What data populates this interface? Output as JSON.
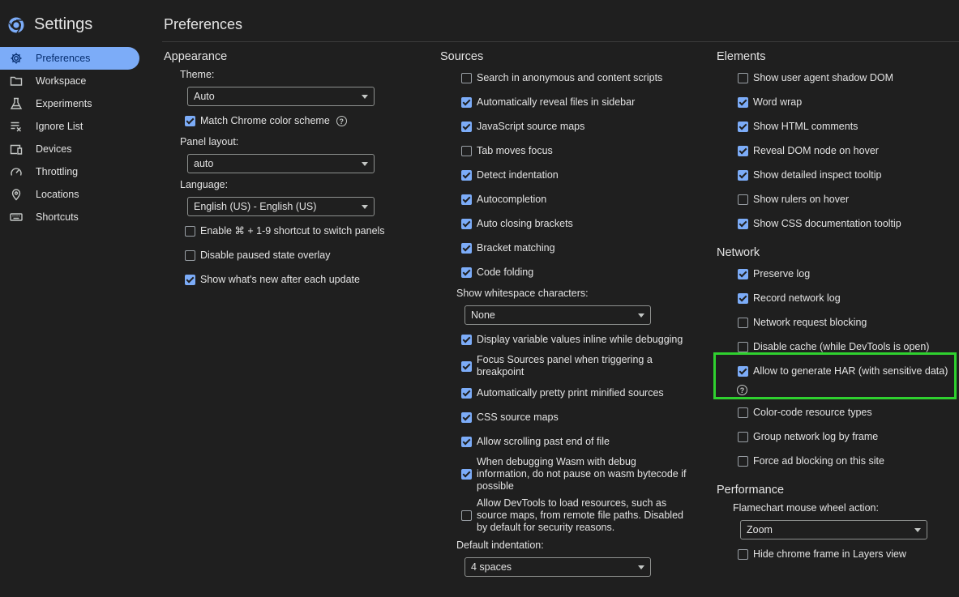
{
  "app": {
    "title": "Settings"
  },
  "sidebar": {
    "items": [
      {
        "label": "Preferences",
        "icon": "gear-icon",
        "active": true
      },
      {
        "label": "Workspace",
        "icon": "folder-icon",
        "active": false
      },
      {
        "label": "Experiments",
        "icon": "flask-icon",
        "active": false
      },
      {
        "label": "Ignore List",
        "icon": "ignore-list-icon",
        "active": false
      },
      {
        "label": "Devices",
        "icon": "devices-icon",
        "active": false
      },
      {
        "label": "Throttling",
        "icon": "speedometer-icon",
        "active": false
      },
      {
        "label": "Locations",
        "icon": "location-pin-icon",
        "active": false
      },
      {
        "label": "Shortcuts",
        "icon": "keyboard-icon",
        "active": false
      }
    ]
  },
  "page": {
    "title": "Preferences"
  },
  "appearance": {
    "title": "Appearance",
    "theme_label": "Theme:",
    "theme_value": "Auto",
    "match_color_scheme": {
      "label": "Match Chrome color scheme",
      "checked": true
    },
    "panel_layout_label": "Panel layout:",
    "panel_layout_value": "auto",
    "language_label": "Language:",
    "language_value": "English (US) - English (US)",
    "options": [
      {
        "label": "Enable ⌘ + 1-9 shortcut to switch panels",
        "checked": false
      },
      {
        "label": "Disable paused state overlay",
        "checked": false
      },
      {
        "label": "Show what's new after each update",
        "checked": true
      }
    ]
  },
  "sources": {
    "title": "Sources",
    "options": [
      {
        "label": "Search in anonymous and content scripts",
        "checked": false
      },
      {
        "label": "Automatically reveal files in sidebar",
        "checked": true
      },
      {
        "label": "JavaScript source maps",
        "checked": true
      },
      {
        "label": "Tab moves focus",
        "checked": false
      },
      {
        "label": "Detect indentation",
        "checked": true
      },
      {
        "label": "Autocompletion",
        "checked": true
      },
      {
        "label": "Auto closing brackets",
        "checked": true
      },
      {
        "label": "Bracket matching",
        "checked": true
      },
      {
        "label": "Code folding",
        "checked": true
      }
    ],
    "whitespace_label": "Show whitespace characters:",
    "whitespace_value": "None",
    "options2": [
      {
        "label": "Display variable values inline while debugging",
        "checked": true
      },
      {
        "label": "Focus Sources panel when triggering a breakpoint",
        "checked": true
      },
      {
        "label": "Automatically pretty print minified sources",
        "checked": true
      },
      {
        "label": "CSS source maps",
        "checked": true
      },
      {
        "label": "Allow scrolling past end of file",
        "checked": true
      },
      {
        "label": "When debugging Wasm with debug information, do not pause on wasm bytecode if possible",
        "checked": true
      },
      {
        "label": "Allow DevTools to load resources, such as source maps, from remote file paths. Disabled by default for security reasons.",
        "checked": false
      }
    ],
    "indentation_label": "Default indentation:",
    "indentation_value": "4 spaces"
  },
  "elements": {
    "title": "Elements",
    "options": [
      {
        "label": "Show user agent shadow DOM",
        "checked": false
      },
      {
        "label": "Word wrap",
        "checked": true
      },
      {
        "label": "Show HTML comments",
        "checked": true
      },
      {
        "label": "Reveal DOM node on hover",
        "checked": true
      },
      {
        "label": "Show detailed inspect tooltip",
        "checked": true
      },
      {
        "label": "Show rulers on hover",
        "checked": false
      },
      {
        "label": "Show CSS documentation tooltip",
        "checked": true
      }
    ]
  },
  "network": {
    "title": "Network",
    "options": [
      {
        "label": "Preserve log",
        "checked": true
      },
      {
        "label": "Record network log",
        "checked": true
      },
      {
        "label": "Network request blocking",
        "checked": false
      },
      {
        "label": "Disable cache (while DevTools is open)",
        "checked": false
      },
      {
        "label": "Allow to generate HAR (with sensitive data)",
        "checked": true
      },
      {
        "label": "Color-code resource types",
        "checked": false
      },
      {
        "label": "Group network log by frame",
        "checked": false
      },
      {
        "label": "Force ad blocking on this site",
        "checked": false
      }
    ]
  },
  "performance": {
    "title": "Performance",
    "wheel_label": "Flamechart mouse wheel action:",
    "wheel_value": "Zoom",
    "options": [
      {
        "label": "Hide chrome frame in Layers view",
        "checked": false
      }
    ]
  },
  "colors": {
    "accent": "#7cacf8",
    "highlight": "#2fd12f",
    "background": "#1f1f1f"
  },
  "help_glyph": "?"
}
